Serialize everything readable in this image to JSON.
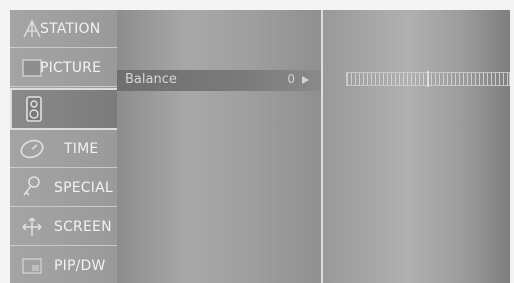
{
  "menu": {
    "items": [
      {
        "label": "STATION",
        "icon": "antenna-icon"
      },
      {
        "label": "PICTURE",
        "icon": "picture-icon"
      },
      {
        "label": "",
        "icon": "speaker-icon",
        "active": true
      },
      {
        "label": "TIME",
        "icon": "clock-icon"
      },
      {
        "label": "SPECIAL",
        "icon": "key-icon"
      },
      {
        "label": "SCREEN",
        "icon": "move-arrows-icon"
      },
      {
        "label": "PIP/DW",
        "icon": "pip-icon"
      }
    ]
  },
  "setting": {
    "label": "Balance",
    "value": "0"
  },
  "balance_scale": {
    "value": 0,
    "min": -50,
    "max": 50
  }
}
